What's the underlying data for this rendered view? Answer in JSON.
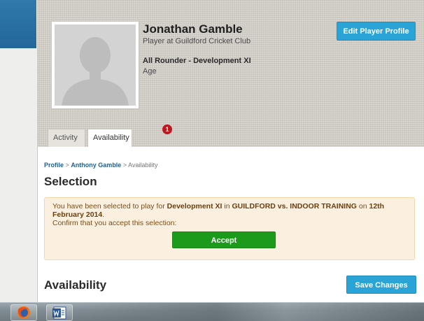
{
  "header": {
    "player_name": "Jonathan Gamble",
    "club": "Player at Guildford Cricket Club",
    "role": "All Rounder - Development XI",
    "age_label": "Age",
    "edit_button": "Edit Player Profile"
  },
  "tabs": [
    {
      "label": "Activity",
      "active": false
    },
    {
      "label": "Availability",
      "active": true,
      "badge": "1"
    }
  ],
  "breadcrumb": {
    "profile": "Profile",
    "separator": ">",
    "person": "Anthony Gamble",
    "current": "Availability"
  },
  "selection": {
    "title": "Selection",
    "notice_prefix": "You have been selected to play for ",
    "team": "Development XI",
    "notice_middle": " in ",
    "match": "GUILDFORD vs. INDOOR TRAINING",
    "notice_on": " on ",
    "date": "12th February 2014",
    "notice_end": ".",
    "confirm_text": "Confirm that you accept this selection:",
    "accept_button": "Accept"
  },
  "availability": {
    "title": "Availability",
    "save_button": "Save Changes"
  },
  "colors": {
    "header_bg": "#d7d3cb",
    "primary_button": "#2aa3d6",
    "accept_button": "#1c9a1c",
    "badge": "#c0171e",
    "notice_bg": "#fbf0df",
    "notice_border": "#f1d8a7",
    "link": "#1e5f8f"
  },
  "taskbar": {
    "items": [
      {
        "icon": "firefox-icon"
      },
      {
        "icon": "word-icon"
      }
    ]
  }
}
